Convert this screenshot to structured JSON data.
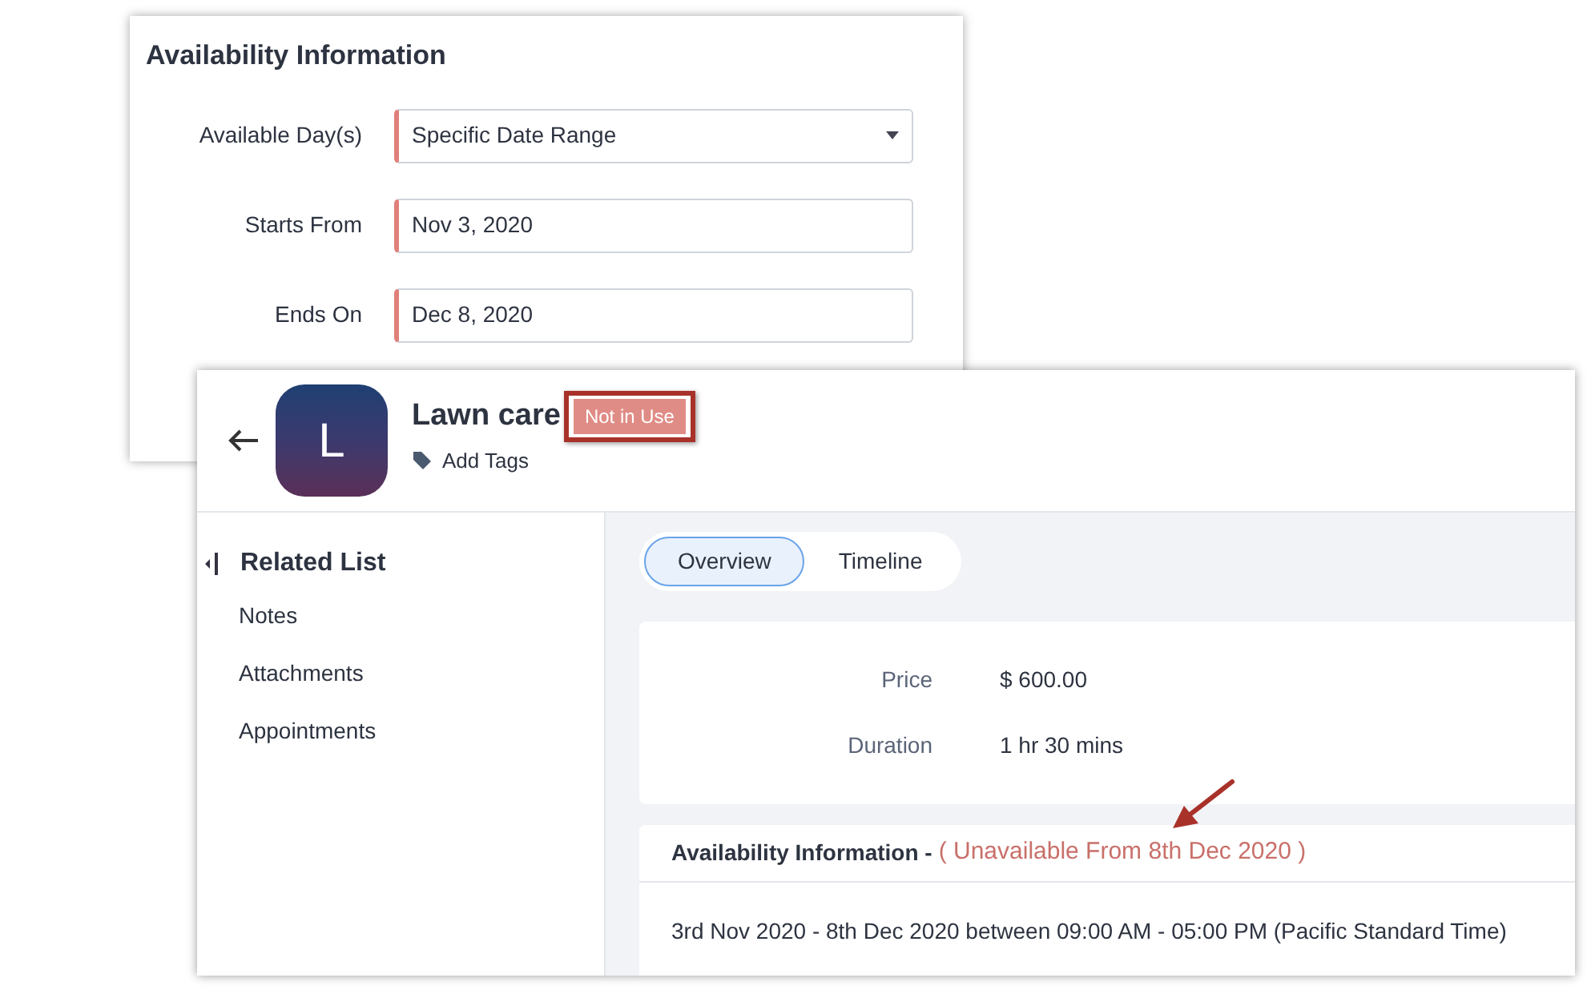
{
  "availability_form": {
    "title": "Availability Information",
    "fields": [
      {
        "label": "Available Day(s)",
        "kind": "dropdown",
        "value": "Specific Date Range"
      },
      {
        "label": "Starts From",
        "kind": "date",
        "value": "Nov 3, 2020"
      },
      {
        "label": "Ends On",
        "kind": "date",
        "value": "Dec 8, 2020"
      }
    ]
  },
  "record": {
    "title": "Lawn care",
    "avatar_letter": "L",
    "status_badge": "Not in Use",
    "add_tags": "Add Tags"
  },
  "sidebar": {
    "title": "Related List",
    "items": [
      "Notes",
      "Attachments",
      "Appointments"
    ]
  },
  "tabs": [
    {
      "label": "Overview",
      "selected": true
    },
    {
      "label": "Timeline",
      "selected": false
    }
  ],
  "details": [
    {
      "label": "Price",
      "value": "$ 600.00"
    },
    {
      "label": "Duration",
      "value": "1 hr 30 mins"
    }
  ],
  "availability": {
    "title": "Availability Information -",
    "note": "( Unavailable From 8th Dec 2020 )",
    "text": "3rd Nov 2020 - 8th Dec 2020 between 09:00 AM - 05:00 PM (Pacific Standard Time)"
  }
}
